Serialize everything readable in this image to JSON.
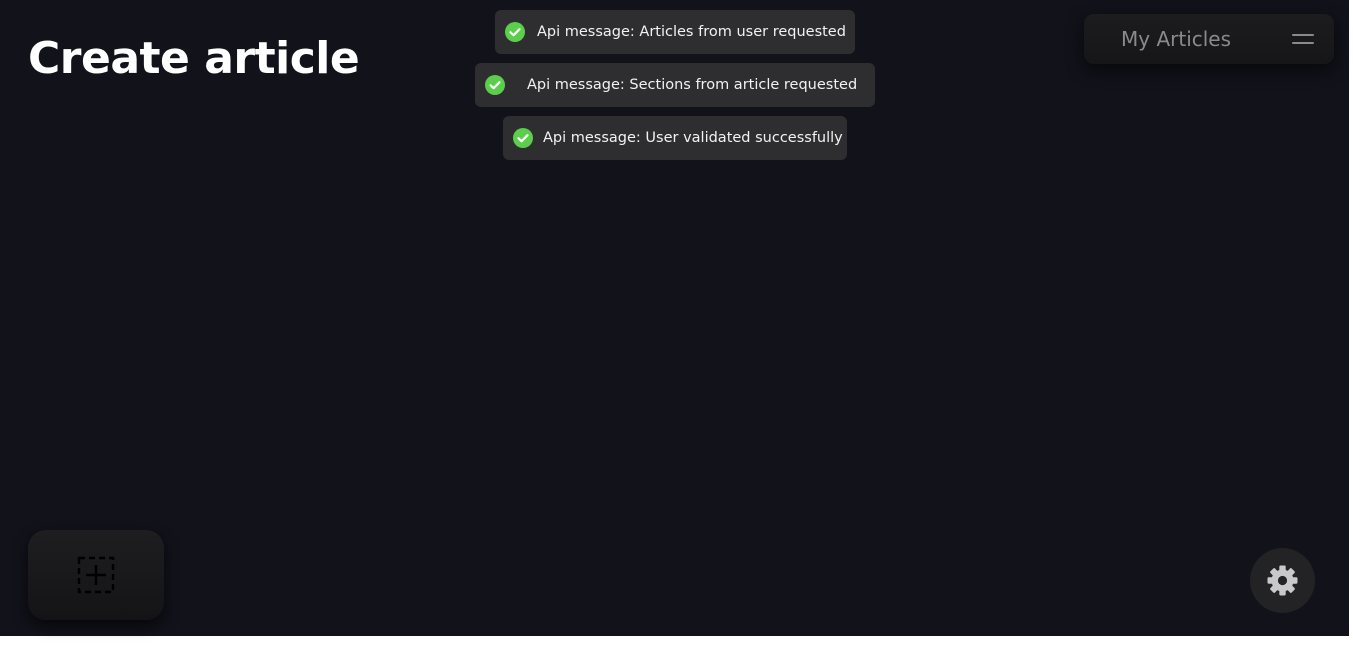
{
  "page": {
    "title": "Create article"
  },
  "toasts": [
    {
      "icon": "check-circle-icon",
      "text": "Api message: Articles from user requested",
      "status_color": "#5bcf4c"
    },
    {
      "icon": "check-circle-icon",
      "text": "Api message: Sections from article requested",
      "status_color": "#5bcf4c"
    },
    {
      "icon": "check-circle-icon",
      "text": "Api message: User validated successfully",
      "status_color": "#5bcf4c"
    }
  ],
  "nav": {
    "label": "My Articles",
    "menu_icon": "menu-icon"
  },
  "actions": {
    "add_icon": "add-section-icon",
    "settings_icon": "gear-icon"
  },
  "colors": {
    "background": "#11121a",
    "toast_background": "#2e2e30",
    "success": "#5bcf4c"
  }
}
